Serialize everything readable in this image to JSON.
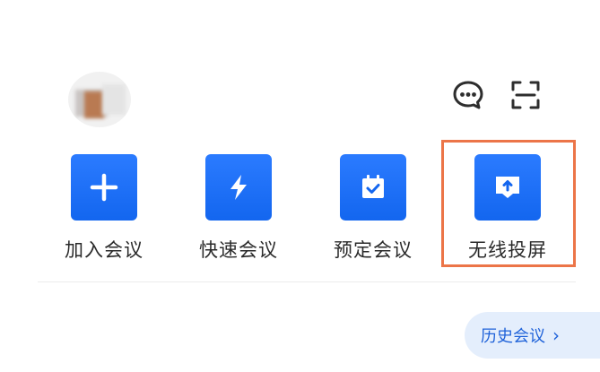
{
  "header": {
    "chat_icon": "chat-bubble-icon",
    "scan_icon": "scan-icon"
  },
  "actions": [
    {
      "label": "加入会议",
      "icon": "plus-icon"
    },
    {
      "label": "快速会议",
      "icon": "lightning-icon"
    },
    {
      "label": "预定会议",
      "icon": "calendar-check-icon"
    },
    {
      "label": "无线投屏",
      "icon": "screen-cast-icon"
    }
  ],
  "history": {
    "label": "历史会议"
  },
  "colors": {
    "tile": "#1366ef",
    "highlight": "#ec7548",
    "history_bg": "#e4eefc",
    "history_text": "#1f62d9"
  }
}
